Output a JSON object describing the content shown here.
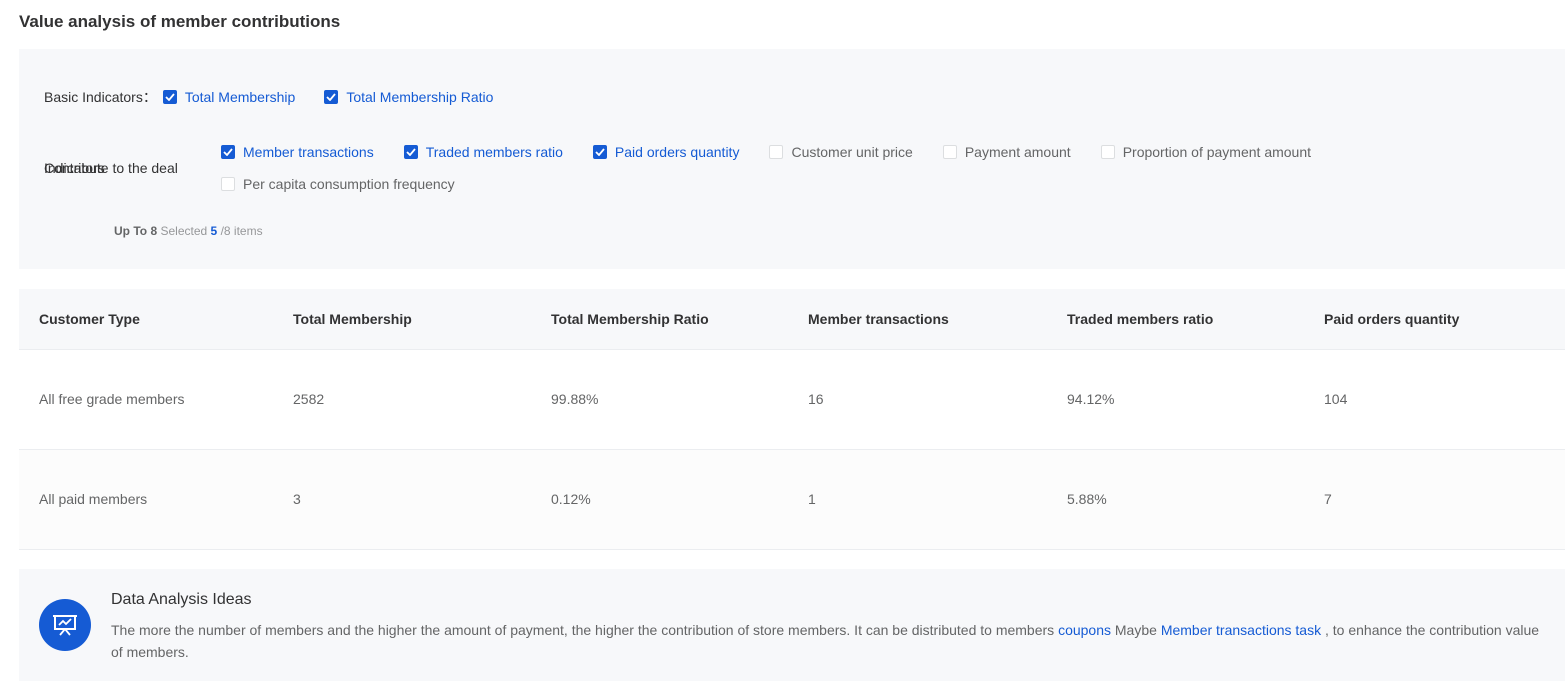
{
  "page_title": "Value analysis of member contributions",
  "filters": {
    "basic_label": "Basic Indicators：",
    "basic_items": [
      {
        "label": "Total Membership",
        "checked": true
      },
      {
        "label": "Total Membership Ratio",
        "checked": true
      }
    ],
    "deal_label_line1": "Indicators",
    "deal_label_line2": "Contribute to the deal",
    "deal_items": [
      {
        "label": "Member transactions",
        "checked": true
      },
      {
        "label": "Traded members ratio",
        "checked": true
      },
      {
        "label": "Paid orders quantity",
        "checked": true
      },
      {
        "label": "Customer unit price",
        "checked": false
      },
      {
        "label": "Payment amount",
        "checked": false
      },
      {
        "label": "Proportion of payment amount",
        "checked": false
      },
      {
        "label": "Per capita consumption frequency",
        "checked": false
      }
    ],
    "note": {
      "up_to_label": "Up To",
      "max": "8",
      "selected_label": "Selected",
      "selected": "5",
      "suffix": "/8 items"
    }
  },
  "table": {
    "headers": [
      "Customer Type",
      "Total Membership",
      "Total Membership Ratio",
      "Member transactions",
      "Traded members ratio",
      "Paid orders quantity"
    ],
    "rows": [
      [
        "All free grade members",
        "2582",
        "99.88%",
        "16",
        "94.12%",
        "104"
      ],
      [
        "All paid members",
        "3",
        "0.12%",
        "1",
        "5.88%",
        "7"
      ]
    ]
  },
  "ideas": {
    "icon": "presentation-chart-icon",
    "title": "Data Analysis Ideas",
    "text_part1": "The more the number of members and the higher the amount of payment, the higher the contribution of store members. It can be distributed to members",
    "link1": "coupons",
    "text_part2": "Maybe",
    "link2": "Member transactions task",
    "text_part3": ", to enhance the contribution value of members."
  },
  "colors": {
    "accent": "#155bd4",
    "panel_bg": "#f7f8fa"
  }
}
